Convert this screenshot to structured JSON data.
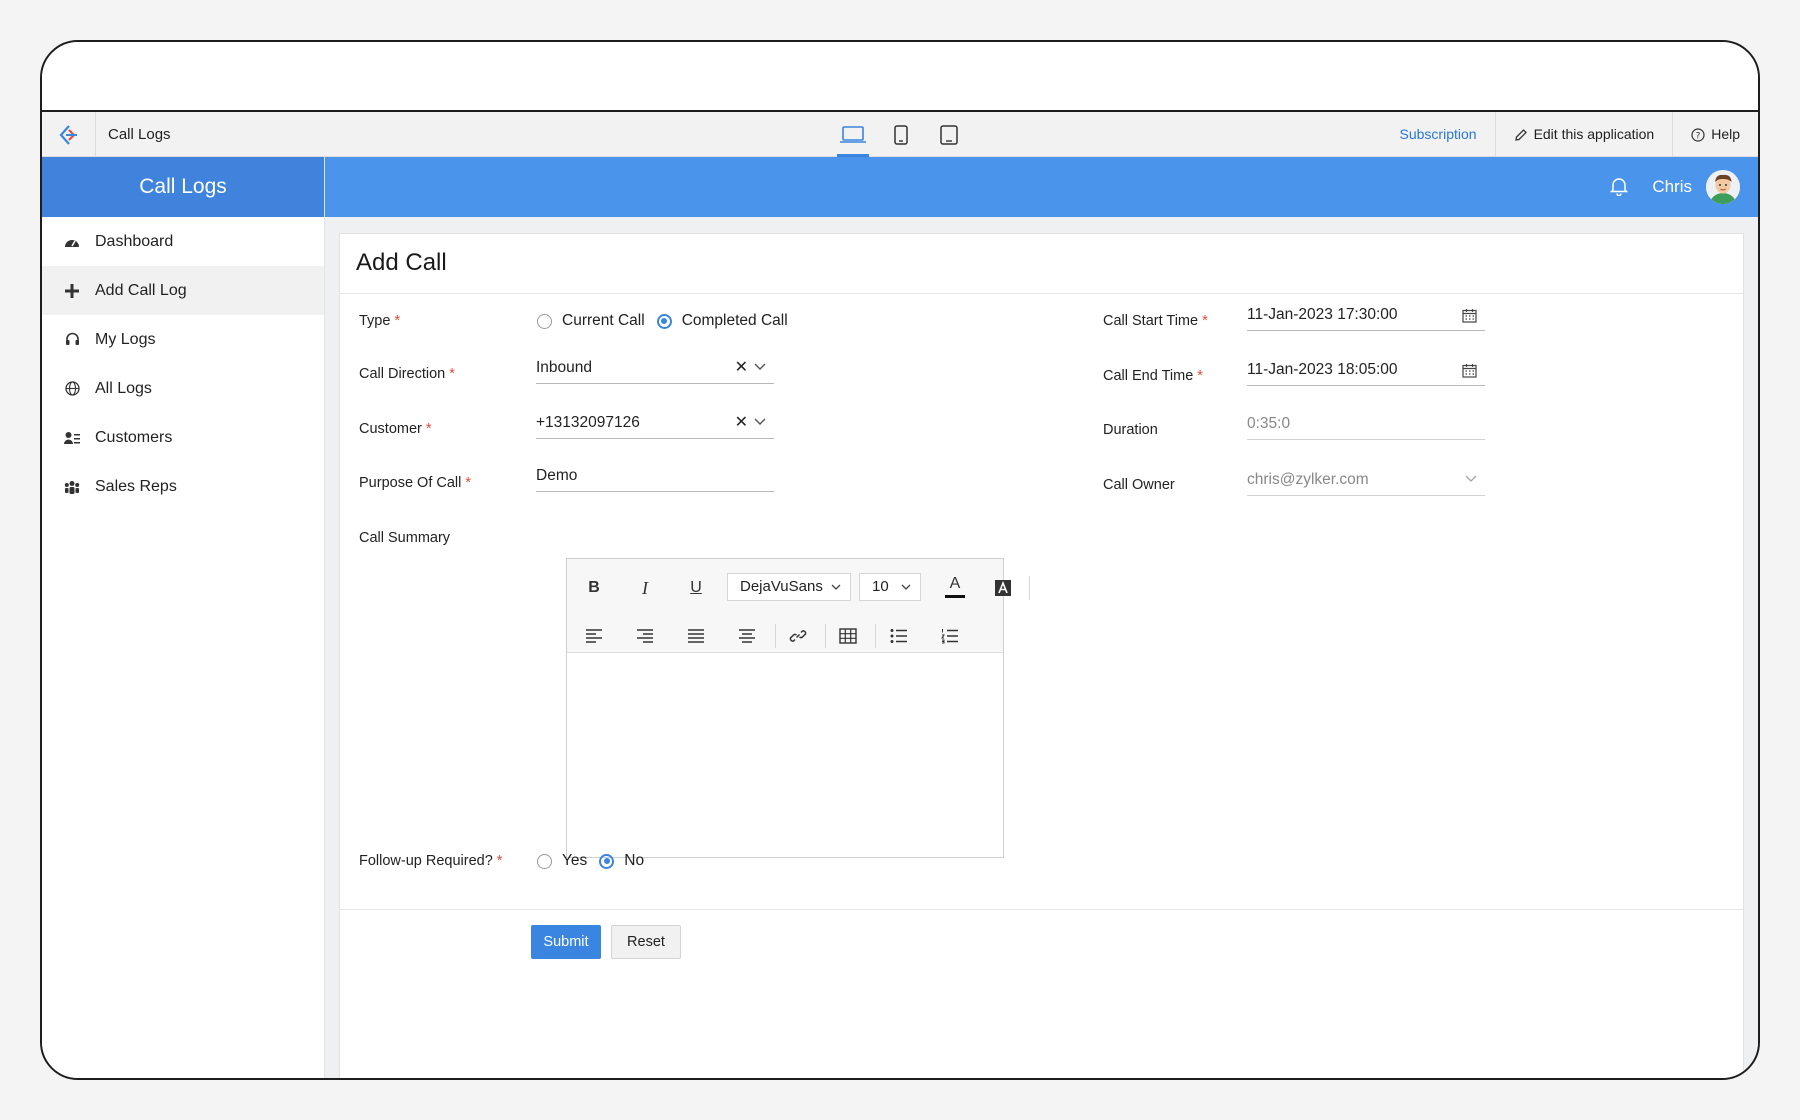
{
  "topbar": {
    "app_title": "Call Logs",
    "subscription": "Subscription",
    "edit_app": "Edit this application",
    "help": "Help"
  },
  "sidebar": {
    "title": "Call Logs",
    "items": [
      {
        "label": "Dashboard",
        "icon": "dashboard-icon"
      },
      {
        "label": "Add Call Log",
        "icon": "plus-icon"
      },
      {
        "label": "My Logs",
        "icon": "headset-icon"
      },
      {
        "label": "All Logs",
        "icon": "globe-icon"
      },
      {
        "label": "Customers",
        "icon": "contacts-icon"
      },
      {
        "label": "Sales Reps",
        "icon": "group-icon"
      }
    ]
  },
  "header": {
    "user_name": "Chris"
  },
  "form": {
    "title": "Add Call",
    "type": {
      "label": "Type",
      "options": [
        "Current Call",
        "Completed Call"
      ],
      "selected": "Completed Call"
    },
    "call_direction": {
      "label": "Call Direction",
      "value": "Inbound"
    },
    "customer": {
      "label": "Customer",
      "value": "+13132097126"
    },
    "purpose": {
      "label": "Purpose Of Call",
      "value": "Demo"
    },
    "call_summary": {
      "label": "Call Summary",
      "font": "DejaVuSans",
      "size": "10",
      "bold": "B",
      "italic": "I",
      "underline": "U",
      "font_color": "A"
    },
    "follow_up": {
      "label": "Follow-up Required?",
      "options": [
        "Yes",
        "No"
      ],
      "selected": "No"
    },
    "call_start": {
      "label": "Call Start Time",
      "value": "11-Jan-2023 17:30:00"
    },
    "call_end": {
      "label": "Call End Time",
      "value": "11-Jan-2023 18:05:00"
    },
    "duration": {
      "label": "Duration",
      "value": "0:35:0"
    },
    "call_owner": {
      "label": "Call Owner",
      "value": "chris@zylker.com"
    },
    "submit": "Submit",
    "reset": "Reset"
  },
  "colors": {
    "accent": "#3a85e0",
    "header_blue": "#4a94ec",
    "sidebar_head": "#3f83dc",
    "required": "#e24a3b"
  }
}
